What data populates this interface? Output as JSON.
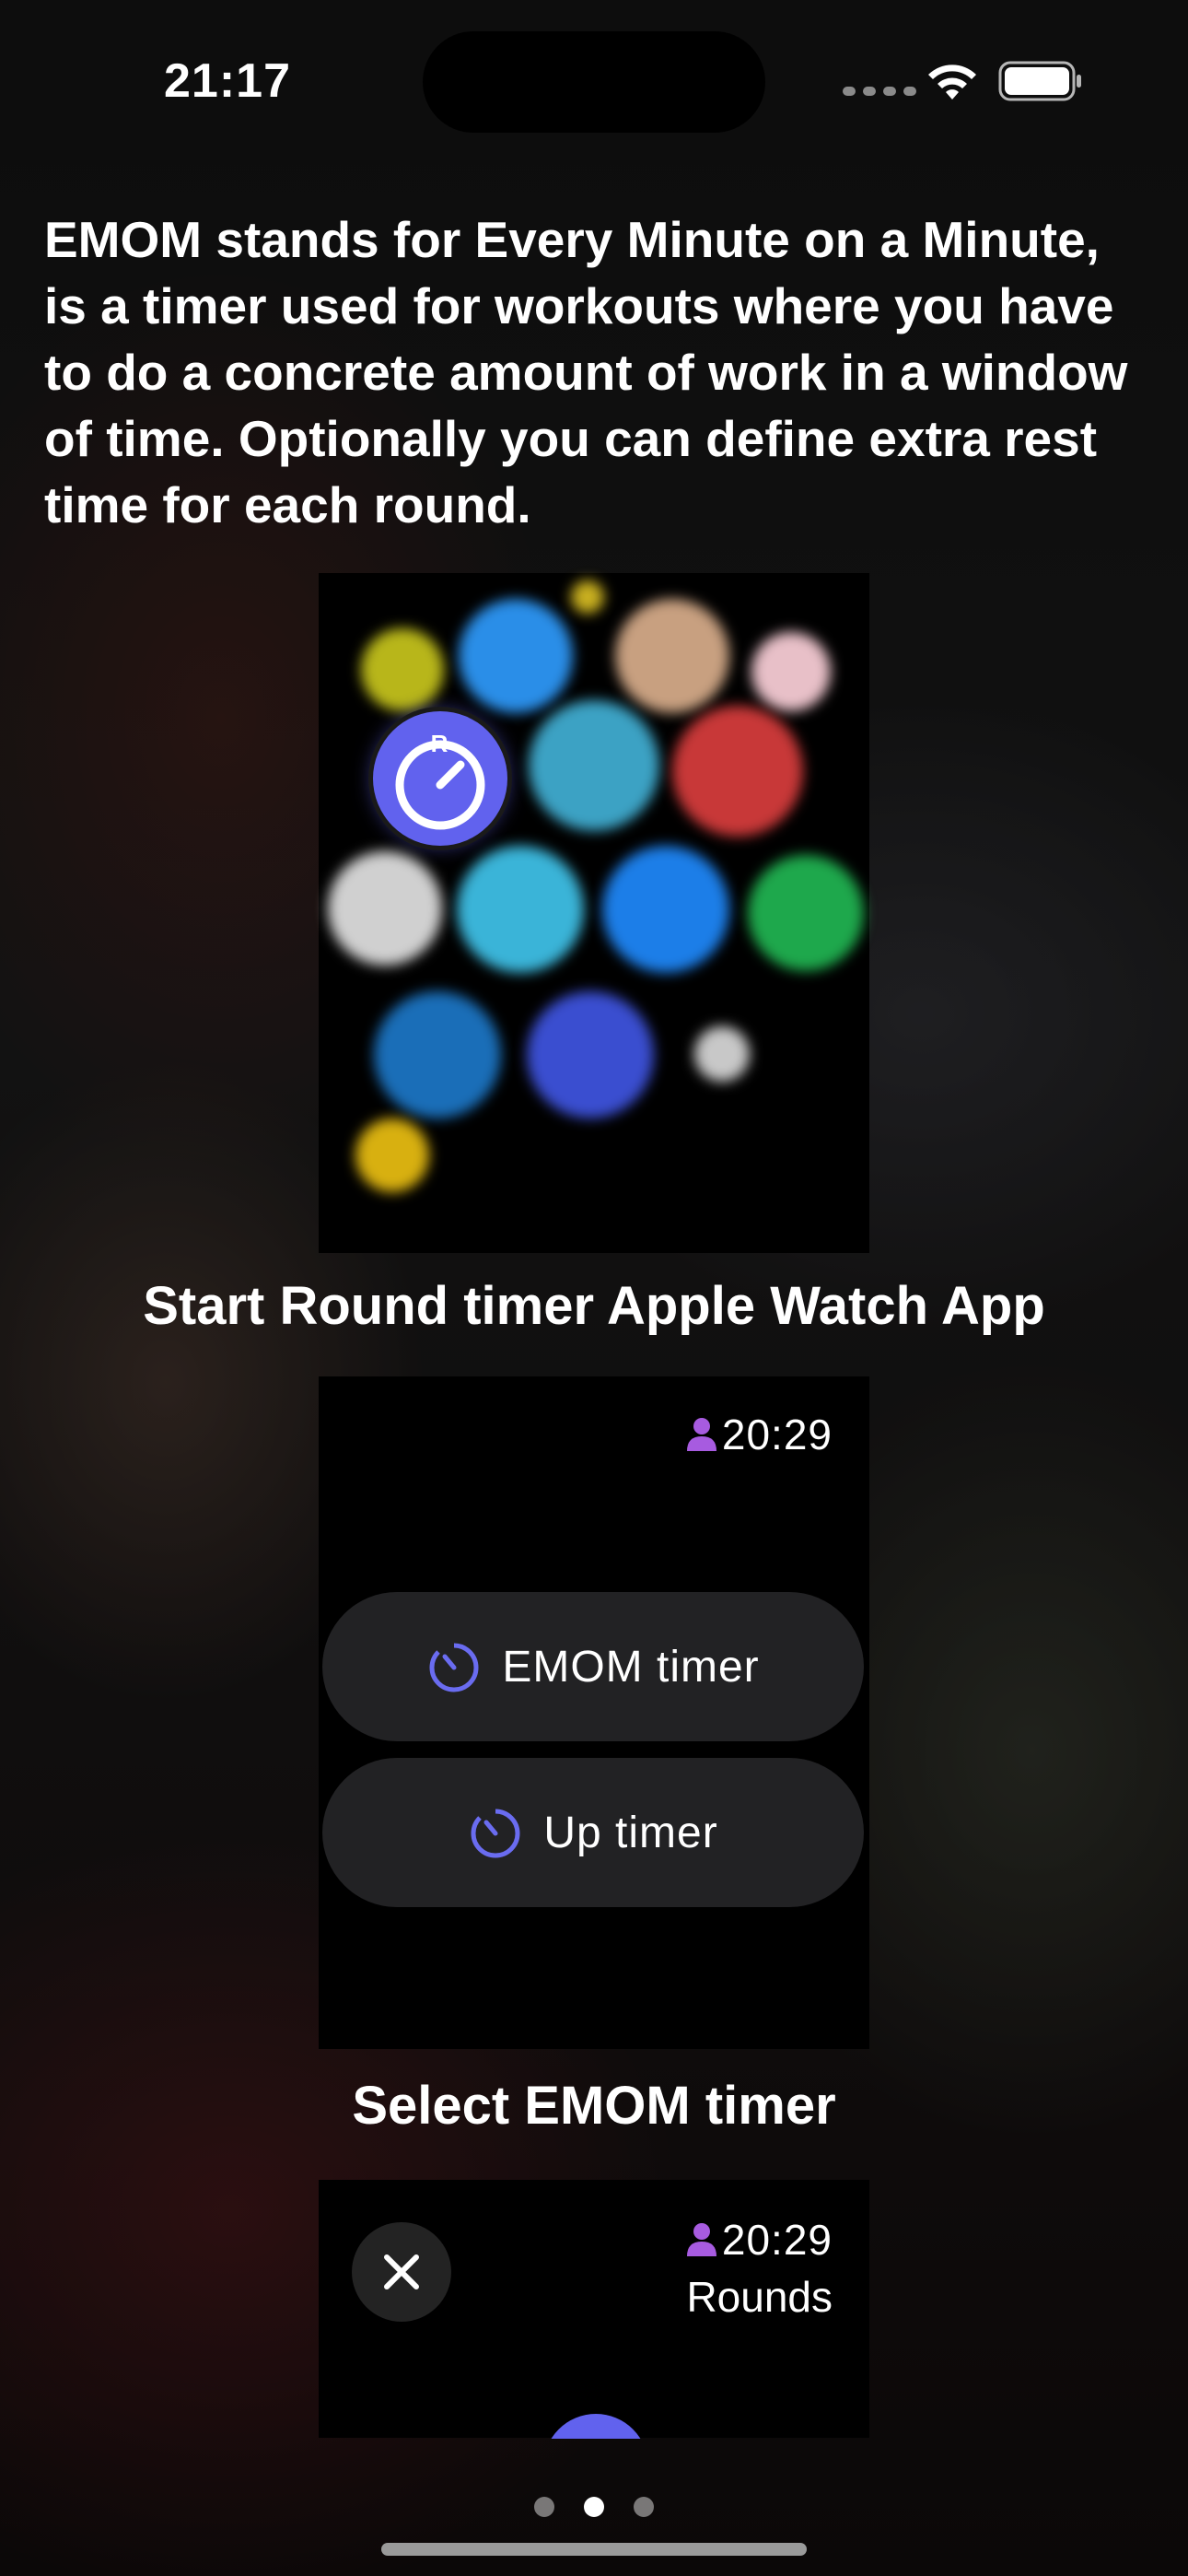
{
  "status_bar": {
    "time": "21:17"
  },
  "intro_text": "EMOM stands for Every Minute on a Minute, is a timer used for workouts where you have to do a concrete amount of work in a window of time. Optionally you can define extra rest time for each round.",
  "steps": [
    {
      "caption": "Start Round timer Apple Watch App"
    },
    {
      "caption": "Select EMOM timer"
    }
  ],
  "watch": {
    "time": "20:29",
    "buttons": [
      {
        "label": "EMOM timer",
        "icon": "timer-icon"
      },
      {
        "label": "Up timer",
        "icon": "timer-icon"
      }
    ],
    "rounds_label": "Rounds",
    "accent": "#6162ee"
  },
  "pager": {
    "count": 3,
    "active_index": 1
  }
}
